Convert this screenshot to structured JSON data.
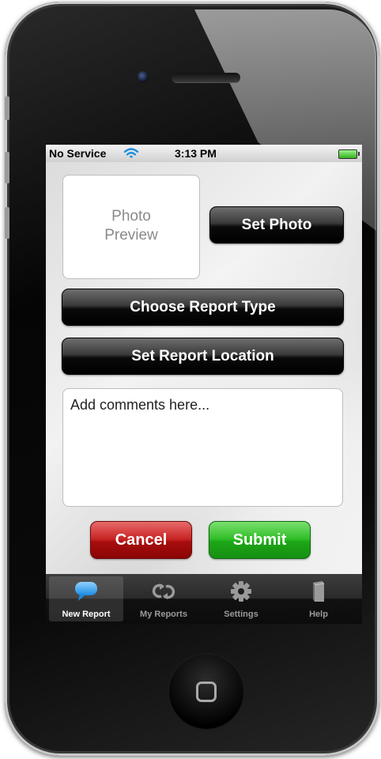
{
  "status_bar": {
    "carrier": "No Service",
    "time": "3:13 PM"
  },
  "photo_preview": {
    "line1": "Photo",
    "line2": "Preview"
  },
  "buttons": {
    "set_photo": "Set Photo",
    "choose_report_type": "Choose Report Type",
    "set_report_location": "Set Report Location",
    "cancel": "Cancel",
    "submit": "Submit"
  },
  "comments": {
    "placeholder": "Add comments here...",
    "value": ""
  },
  "tab_bar": {
    "active_tab": "New Report",
    "tabs": [
      {
        "label": "New Report",
        "icon": "speech-bubble-icon"
      },
      {
        "label": "My Reports",
        "icon": "refresh-icon"
      },
      {
        "label": "Settings",
        "icon": "gear-icon"
      },
      {
        "label": "Help",
        "icon": "book-icon"
      }
    ]
  },
  "colors": {
    "cancel": "#c82323",
    "submit": "#2fbd26",
    "active_tab_icon": "#3fa9f5"
  }
}
